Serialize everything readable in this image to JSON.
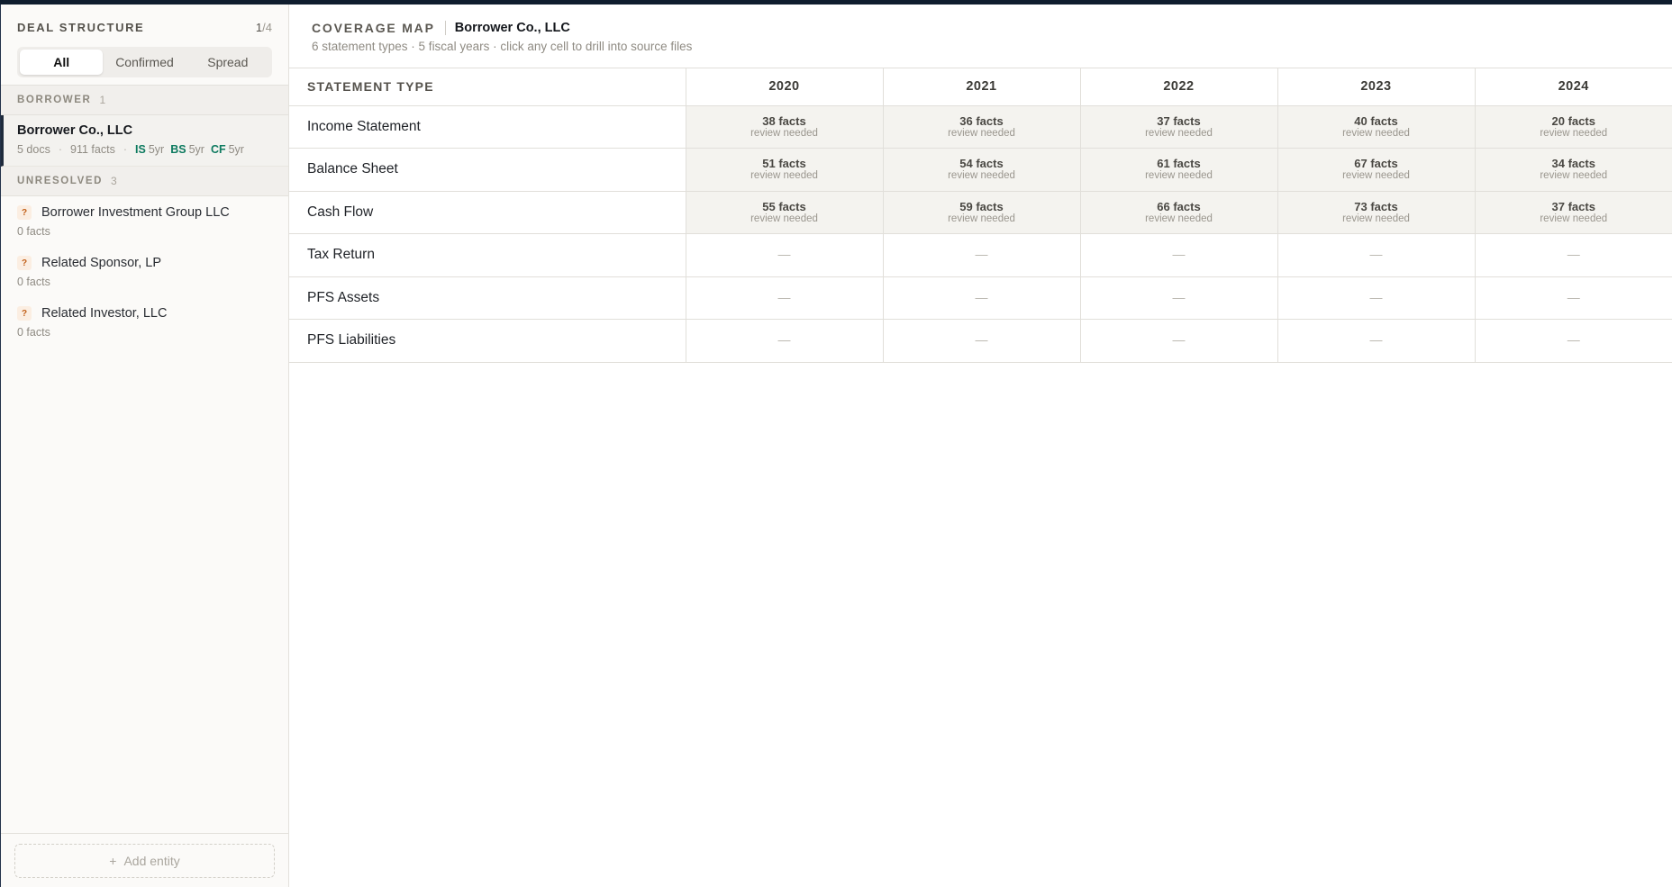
{
  "sidebar": {
    "title": "DEAL STRUCTURE",
    "count_current": "1",
    "count_total": "/4",
    "filters": [
      {
        "label": "All",
        "active": true
      },
      {
        "label": "Confirmed",
        "active": false
      },
      {
        "label": "Spread",
        "active": false
      }
    ],
    "borrower_section": {
      "label": "BORROWER",
      "count": "1"
    },
    "selected_entity": {
      "name": "Borrower Co., LLC",
      "docs": "5 docs",
      "facts": "911 facts",
      "badges": [
        {
          "key": "IS",
          "value": "5yr"
        },
        {
          "key": "BS",
          "value": "5yr"
        },
        {
          "key": "CF",
          "value": "5yr"
        }
      ]
    },
    "unresolved_section": {
      "label": "UNRESOLVED",
      "count": "3"
    },
    "unresolved": [
      {
        "icon": "?",
        "name": "Borrower Investment Group LLC",
        "facts": "0 facts"
      },
      {
        "icon": "?",
        "name": "Related Sponsor, LP",
        "facts": "0 facts"
      },
      {
        "icon": "?",
        "name": "Related Investor, LLC",
        "facts": "0 facts"
      }
    ],
    "add_entity": {
      "plus": "+",
      "label": "Add entity"
    }
  },
  "main": {
    "label": "COVERAGE MAP",
    "entity": "Borrower Co., LLC",
    "subtitle": "6 statement types · 5 fiscal years · click any cell to drill into source files",
    "table": {
      "type_header": "STATEMENT TYPE",
      "years": [
        "2020",
        "2021",
        "2022",
        "2023",
        "2024"
      ],
      "rows": [
        {
          "label": "Income Statement",
          "cells": [
            {
              "facts": "38 facts",
              "status": "review needed"
            },
            {
              "facts": "36 facts",
              "status": "review needed"
            },
            {
              "facts": "37 facts",
              "status": "review needed"
            },
            {
              "facts": "40 facts",
              "status": "review needed"
            },
            {
              "facts": "20 facts",
              "status": "review needed"
            }
          ]
        },
        {
          "label": "Balance Sheet",
          "cells": [
            {
              "facts": "51 facts",
              "status": "review needed"
            },
            {
              "facts": "54 facts",
              "status": "review needed"
            },
            {
              "facts": "61 facts",
              "status": "review needed"
            },
            {
              "facts": "67 facts",
              "status": "review needed"
            },
            {
              "facts": "34 facts",
              "status": "review needed"
            }
          ]
        },
        {
          "label": "Cash Flow",
          "cells": [
            {
              "facts": "55 facts",
              "status": "review needed"
            },
            {
              "facts": "59 facts",
              "status": "review needed"
            },
            {
              "facts": "66 facts",
              "status": "review needed"
            },
            {
              "facts": "73 facts",
              "status": "review needed"
            },
            {
              "facts": "37 facts",
              "status": "review needed"
            }
          ]
        },
        {
          "label": "Tax Return",
          "cells": [
            {
              "empty": "—"
            },
            {
              "empty": "—"
            },
            {
              "empty": "—"
            },
            {
              "empty": "—"
            },
            {
              "empty": "—"
            }
          ]
        },
        {
          "label": "PFS Assets",
          "cells": [
            {
              "empty": "—"
            },
            {
              "empty": "—"
            },
            {
              "empty": "—"
            },
            {
              "empty": "—"
            },
            {
              "empty": "—"
            }
          ]
        },
        {
          "label": "PFS Liabilities",
          "cells": [
            {
              "empty": "—"
            },
            {
              "empty": "—"
            },
            {
              "empty": "—"
            },
            {
              "empty": "—"
            },
            {
              "empty": "—"
            }
          ]
        }
      ]
    }
  }
}
